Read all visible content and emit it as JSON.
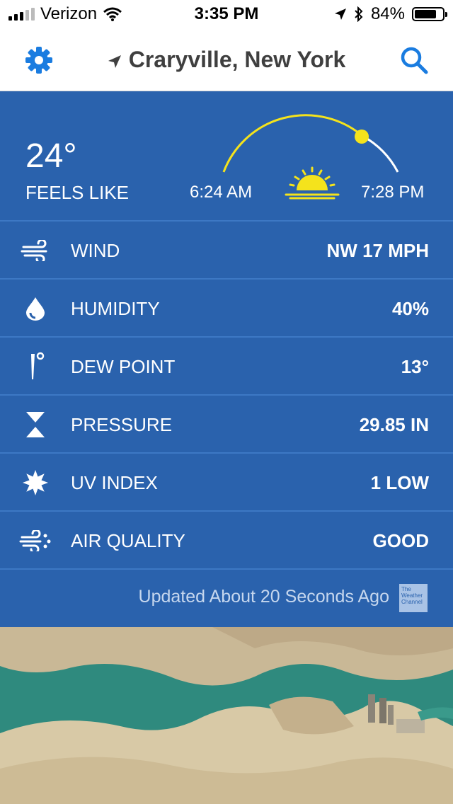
{
  "status": {
    "carrier": "Verizon",
    "time": "3:35 PM",
    "battery": "84%",
    "battery_level": 0.84
  },
  "header": {
    "location": "Craryville, New York"
  },
  "current": {
    "temp": "24°",
    "feels_like_label": "FEELS LIKE",
    "sunrise": "6:24 AM",
    "sunset": "7:28 PM"
  },
  "details": [
    {
      "label": "WIND",
      "value": "NW 17 MPH",
      "icon": "wind-icon"
    },
    {
      "label": "HUMIDITY",
      "value": "40%",
      "icon": "humidity-drop-icon"
    },
    {
      "label": "DEW POINT",
      "value": "13°",
      "icon": "dew-point-icon"
    },
    {
      "label": "PRESSURE",
      "value": "29.85 IN",
      "icon": "pressure-icon"
    },
    {
      "label": "UV INDEX",
      "value": "1 LOW",
      "icon": "uv-sun-icon"
    },
    {
      "label": "AIR QUALITY",
      "value": "GOOD",
      "icon": "air-quality-icon"
    }
  ],
  "footer": {
    "updated": "Updated About 20 Seconds Ago",
    "logo_text": "The Weather Channel"
  },
  "colors": {
    "panel": "#2a62ad",
    "accent": "#1a7ce0",
    "sun": "#f4e31c"
  }
}
